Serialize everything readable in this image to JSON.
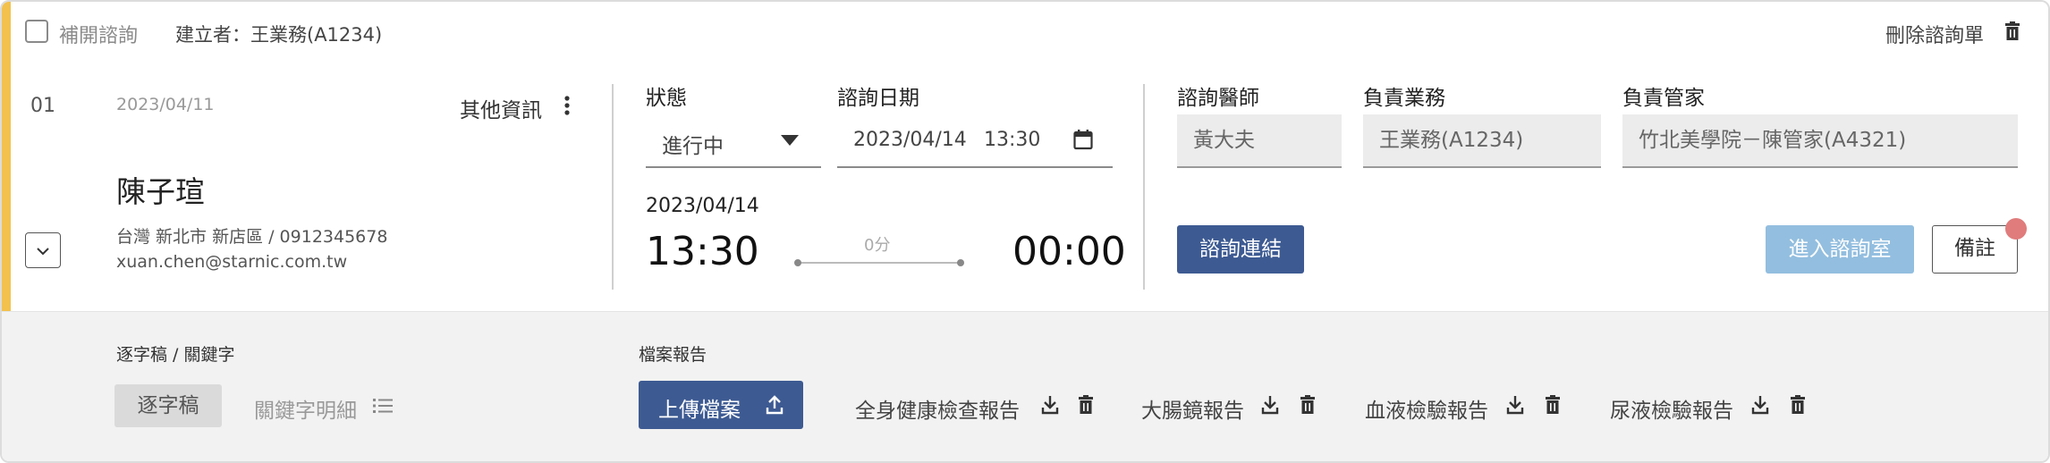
{
  "header": {
    "reopen_label": "補開諮詢",
    "creator": "建立者：王業務(A1234)",
    "delete_label": "刪除諮詢單"
  },
  "client": {
    "index": "01",
    "date": "2023/04/11",
    "other_info_label": "其他資訊",
    "name": "陳子瑄",
    "address_phone": "台灣 新北市 新店區 / 0912345678",
    "email": "xuan.chen@starnic.com.tw"
  },
  "consult": {
    "status_label": "狀態",
    "status_value": "進行中",
    "date_label": "諮詢日期",
    "date_value": "2023/04/14",
    "time_value": "13:30",
    "session_date": "2023/04/14",
    "start_time": "13:30",
    "duration": "0分",
    "end_time": "00:00"
  },
  "staff": {
    "doctor_label": "諮詢醫師",
    "doctor_value": "黃大夫",
    "sales_label": "負責業務",
    "sales_value": "王業務(A1234)",
    "manager_label": "負責管家",
    "manager_value": "竹北美學院－陳管家(A4321)"
  },
  "actions": {
    "link_label": "諮詢連結",
    "enter_room_label": "進入諮詢室",
    "notes_label": "備註"
  },
  "transcript": {
    "section_label": "逐字稿 / 關鍵字",
    "transcript_btn": "逐字稿",
    "keywords_btn": "關鍵字明細"
  },
  "reports": {
    "section_label": "檔案報告",
    "upload_label": "上傳檔案",
    "items": [
      {
        "label": "全身健康檢查報告"
      },
      {
        "label": "大腸鏡報告"
      },
      {
        "label": "血液檢驗報告"
      },
      {
        "label": "尿液檢驗報告"
      }
    ]
  },
  "colors": {
    "accent": "#f2c14e",
    "navy": "#3d5a92",
    "light_blue": "#93bedf",
    "badge": "#e07c7c"
  }
}
